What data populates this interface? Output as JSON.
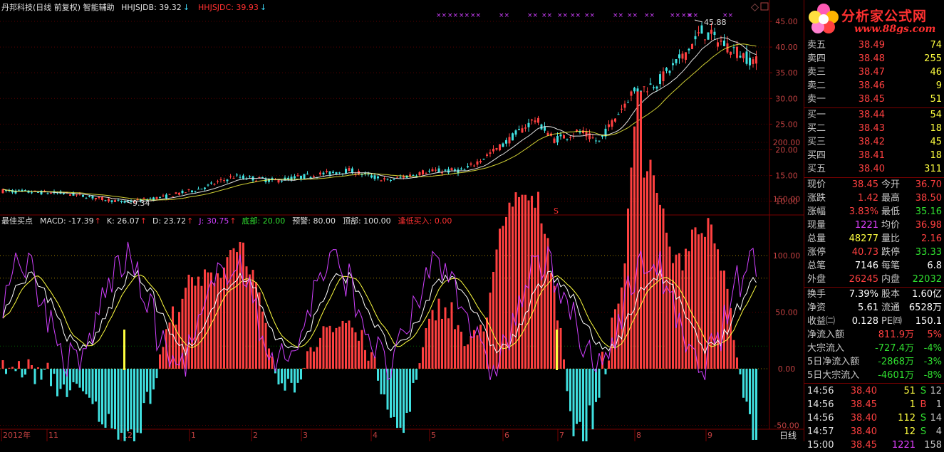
{
  "header": {
    "title": "丹邦科技(日线 前复权) 智能辅助",
    "indicators": [
      {
        "label": "HHJSJDB: 39.32",
        "color": "#e0e0e0",
        "arrow": "↓",
        "arrow_color": "#40e0ff"
      },
      {
        "label": "HHJSJDC: 39.93",
        "color": "#ff3030",
        "arrow": "↓",
        "arrow_color": "#40e0ff"
      }
    ]
  },
  "sub_header": {
    "items": [
      {
        "label": "最佳买点",
        "color": "#e0e0e0",
        "arrow": ""
      },
      {
        "label": "MACD: -17.39",
        "color": "#e0e0e0",
        "arrow": "↑"
      },
      {
        "label": "K: 26.07",
        "color": "#e0e0e0",
        "arrow": "↑"
      },
      {
        "label": "D: 23.72",
        "color": "#e0e0e0",
        "arrow": "↑"
      },
      {
        "label": "J: 30.75",
        "color": "#d040ff",
        "arrow": "↑"
      },
      {
        "label": "底部: 20.00",
        "color": "#30e030",
        "arrow": ""
      },
      {
        "label": "预警: 80.00",
        "color": "#e0e0e0",
        "arrow": ""
      },
      {
        "label": "顶部: 100.00",
        "color": "#e0e0e0",
        "arrow": ""
      },
      {
        "label": "逢低买入: 0.00",
        "color": "#ff3030",
        "arrow": ""
      }
    ]
  },
  "price_axis": {
    "ticks": [
      "45.00",
      "40.00",
      "35.00",
      "30.00",
      "25.00",
      "20.00",
      "15.00",
      "10.00"
    ]
  },
  "indicator_axis": {
    "ticks": [
      "200.00",
      "150.00",
      "100.00",
      "50.00",
      "0.00",
      "-50.00"
    ]
  },
  "time_axis": {
    "labels": [
      "2012年",
      "11",
      "12",
      "1",
      "2",
      "3",
      "4",
      "5",
      "6",
      "7",
      "8",
      "9"
    ],
    "period_button": "日线"
  },
  "annotations": {
    "high": "45.88",
    "low": "9.34",
    "marker": "S"
  },
  "colors": {
    "up": "#ff4040",
    "down": "#40e0e0",
    "ma_white": "#e0e0e0",
    "ma_yellow": "#ffff40",
    "j_line": "#d040ff",
    "grid": "#7a0000"
  },
  "logo": {
    "text": "分析家公式网",
    "url": "www.88gs.com"
  },
  "order_book": {
    "sell": [
      {
        "label": "卖五",
        "price": "38.49",
        "vol": "74"
      },
      {
        "label": "卖四",
        "price": "38.48",
        "vol": "255"
      },
      {
        "label": "卖三",
        "price": "38.47",
        "vol": "46"
      },
      {
        "label": "卖二",
        "price": "38.46",
        "vol": "9"
      },
      {
        "label": "卖一",
        "price": "38.45",
        "vol": "51"
      }
    ],
    "buy": [
      {
        "label": "买一",
        "price": "38.44",
        "vol": "54"
      },
      {
        "label": "买二",
        "price": "38.43",
        "vol": "18"
      },
      {
        "label": "买三",
        "price": "38.42",
        "vol": "45"
      },
      {
        "label": "买四",
        "price": "38.41",
        "vol": "18"
      },
      {
        "label": "买五",
        "price": "38.40",
        "vol": "311"
      }
    ]
  },
  "quote": [
    {
      "a": "现价",
      "b": "38.45",
      "bc": "red",
      "c": "今开",
      "d": "36.70",
      "dc": "red"
    },
    {
      "a": "涨跌",
      "b": "1.42",
      "bc": "red",
      "c": "最高",
      "d": "38.50",
      "dc": "red"
    },
    {
      "a": "涨幅",
      "b": "3.83%",
      "bc": "red",
      "c": "最低",
      "d": "35.16",
      "dc": "green"
    },
    {
      "a": "现量",
      "b": "1221",
      "bc": "purple",
      "c": "均价",
      "d": "36.98",
      "dc": "red"
    },
    {
      "a": "总量",
      "b": "48277",
      "bc": "yellow",
      "c": "量比",
      "d": "2.16",
      "dc": "red"
    },
    {
      "a": "涨停",
      "b": "40.73",
      "bc": "red",
      "c": "跌停",
      "d": "33.33",
      "dc": "green"
    },
    {
      "a": "总笔",
      "b": "7146",
      "bc": "white",
      "c": "每笔",
      "d": "6.8",
      "dc": "white"
    },
    {
      "a": "外盘",
      "b": "26245",
      "bc": "red",
      "c": "内盘",
      "d": "22032",
      "dc": "green"
    }
  ],
  "fundamentals": [
    {
      "a": "换手",
      "b": "7.39%",
      "c": "股本",
      "d": "1.60亿"
    },
    {
      "a": "净资",
      "b": "5.61",
      "c": "流通",
      "d": "6528万"
    },
    {
      "a": "收益㈡",
      "b": "0.128",
      "c": "PE㈣",
      "d": "150.1"
    }
  ],
  "flows": [
    {
      "a": "净流入额",
      "b": "811.9万",
      "bc": "red",
      "c": "5%",
      "cc": "red"
    },
    {
      "a": "大宗流入",
      "b": "-727.4万",
      "bc": "green",
      "c": "-4%",
      "cc": "green"
    },
    {
      "a": "5日净流入额",
      "b": "-2868万",
      "bc": "green",
      "c": "-3%",
      "cc": "green"
    },
    {
      "a": "5日大宗流入",
      "b": "-4601万",
      "bc": "green",
      "c": "-8%",
      "cc": "green"
    }
  ],
  "ticks": [
    {
      "time": "14:56",
      "price": "38.40",
      "pc": "red",
      "vol": "51",
      "vc": "yellow",
      "bs": "S",
      "bsc": "green",
      "n": "12"
    },
    {
      "time": "14:56",
      "price": "38.45",
      "pc": "red",
      "vol": "1",
      "vc": "yellow",
      "bs": "B",
      "bsc": "red",
      "n": "1"
    },
    {
      "time": "14:56",
      "price": "38.40",
      "pc": "red",
      "vol": "112",
      "vc": "yellow",
      "bs": "S",
      "bsc": "green",
      "n": "14"
    },
    {
      "time": "14:57",
      "price": "38.40",
      "pc": "red",
      "vol": "12",
      "vc": "yellow",
      "bs": "S",
      "bsc": "green",
      "n": "4"
    },
    {
      "time": "15:00",
      "price": "38.45",
      "pc": "red",
      "vol": "1221",
      "vc": "purple",
      "bs": "",
      "bsc": "white",
      "n": "158"
    }
  ]
}
